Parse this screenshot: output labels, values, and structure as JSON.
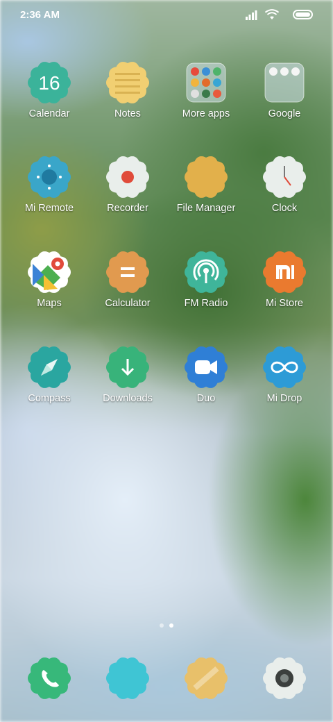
{
  "status": {
    "time": "2:36 AM"
  },
  "icons": {
    "signal": "signal-icon",
    "wifi": "wifi-icon",
    "battery": "battery-icon"
  },
  "apps": [
    {
      "label": "Calendar",
      "name": "calendar",
      "color": "#3bb39a",
      "glyph": "16"
    },
    {
      "label": "Notes",
      "name": "notes",
      "color": "#f1cf72"
    },
    {
      "label": "More apps",
      "name": "more-apps",
      "color": "#c9d7e3"
    },
    {
      "label": "Google",
      "name": "google",
      "color": "#c9d7e3"
    },
    {
      "label": "Mi Remote",
      "name": "mi-remote",
      "color": "#3aa6c9"
    },
    {
      "label": "Recorder",
      "name": "recorder",
      "color": "#e9eeeb"
    },
    {
      "label": "File Manager",
      "name": "file-manager",
      "color": "#e2b04b"
    },
    {
      "label": "Clock",
      "name": "clock",
      "color": "#e9eeeb"
    },
    {
      "label": "Maps",
      "name": "maps",
      "color": "#ffffff"
    },
    {
      "label": "Calculator",
      "name": "calculator",
      "color": "#e19a4f",
      "glyph": "="
    },
    {
      "label": "FM Radio",
      "name": "fm-radio",
      "color": "#3fb59a"
    },
    {
      "label": "Mi Store",
      "name": "mi-store",
      "color": "#ea7a2f",
      "glyph": "mi"
    },
    {
      "label": "Compass",
      "name": "compass",
      "color": "#2aa6a0"
    },
    {
      "label": "Downloads",
      "name": "downloads",
      "color": "#38b37a"
    },
    {
      "label": "Duo",
      "name": "duo",
      "color": "#2f7fd6"
    },
    {
      "label": "Mi Drop",
      "name": "mi-drop",
      "color": "#2d9bd6"
    }
  ],
  "dock": [
    {
      "name": "phone",
      "color": "#37b87a"
    },
    {
      "name": "messages",
      "color": "#3fc5d4"
    },
    {
      "name": "gallery",
      "color": "#e8c06a"
    },
    {
      "name": "camera",
      "color": "#e9eeeb"
    }
  ],
  "pager": {
    "pages": 2,
    "current": 2
  }
}
